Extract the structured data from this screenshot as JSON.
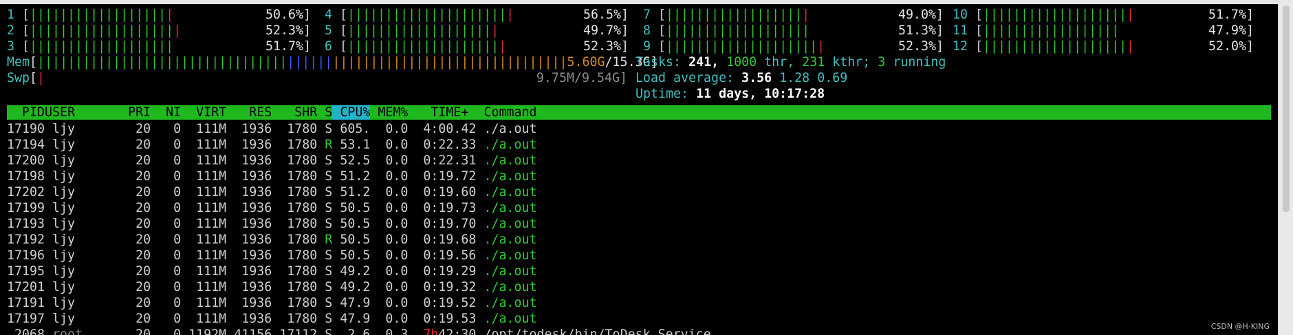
{
  "cpus": [
    {
      "id": "1",
      "pct": "50.6%]",
      "col": 0,
      "row": 0,
      "green": 18,
      "red": 1
    },
    {
      "id": "2",
      "pct": "52.3%]",
      "col": 0,
      "row": 1,
      "green": 19,
      "red": 1
    },
    {
      "id": "3",
      "pct": "51.7%]",
      "col": 0,
      "row": 2,
      "green": 19,
      "red": 0
    },
    {
      "id": "4",
      "pct": "56.5%]",
      "col": 1,
      "row": 0,
      "green": 21,
      "red": 1
    },
    {
      "id": "5",
      "pct": "49.7%]",
      "col": 1,
      "row": 1,
      "green": 19,
      "red": 1
    },
    {
      "id": "6",
      "pct": "52.3%]",
      "col": 1,
      "row": 2,
      "green": 20,
      "red": 1
    },
    {
      "id": "7",
      "pct": "49.0%]",
      "col": 2,
      "row": 0,
      "green": 18,
      "red": 1
    },
    {
      "id": "8",
      "pct": "51.3%]",
      "col": 2,
      "row": 1,
      "green": 19,
      "red": 0
    },
    {
      "id": "9",
      "pct": "52.3%]",
      "col": 2,
      "row": 2,
      "green": 20,
      "red": 1
    },
    {
      "id": "10",
      "pct": "51.7%]",
      "col": 3,
      "row": 0,
      "green": 19,
      "red": 1
    },
    {
      "id": "11",
      "pct": "47.9%]",
      "col": 3,
      "row": 1,
      "green": 18,
      "red": 0
    },
    {
      "id": "12",
      "pct": "52.0%]",
      "col": 3,
      "row": 2,
      "green": 19,
      "red": 1
    }
  ],
  "mem": {
    "label": "Mem",
    "used": "5.60G",
    "total": "/15.3G]",
    "green": 33,
    "blue": 6,
    "orange": 31
  },
  "swp": {
    "label": "Swp",
    "used": "9.75M/9.54G]"
  },
  "tasks": {
    "label": "Tasks:",
    "count": "241,",
    "thr_count": "1000",
    "thr_label": "thr,",
    "kthr_count": "231",
    "kthr_label": "kthr;",
    "running_count": "3",
    "running_label": "running"
  },
  "load": {
    "label": "Load average:",
    "one": "3.56",
    "five": "1.28",
    "fifteen": "0.69"
  },
  "uptime": {
    "label": "Uptime:",
    "value": "11 days, 10:17:28"
  },
  "columns": [
    "  PID",
    "USER      ",
    " PRI",
    "  NI",
    "  VIRT",
    "   RES",
    "   SHR",
    " S",
    " CPU%",
    " MEM%",
    "   TIME+ ",
    " Command"
  ],
  "processes": [
    {
      "pid": "17190",
      "user": "ljy",
      "pri": "20",
      "ni": "0",
      "virt": "111M",
      "res": "1936",
      "shr": "1780",
      "s": "S",
      "cpu": "605.",
      "mem": "0.0",
      "time": "4:00.42",
      "cmd": "./a.out"
    },
    {
      "pid": "17194",
      "user": "ljy",
      "pri": "20",
      "ni": "0",
      "virt": "111M",
      "res": "1936",
      "shr": "1780",
      "s": "R",
      "cpu": "53.1",
      "mem": "0.0",
      "time": "0:22.33",
      "cmd": "./a.out"
    },
    {
      "pid": "17200",
      "user": "ljy",
      "pri": "20",
      "ni": "0",
      "virt": "111M",
      "res": "1936",
      "shr": "1780",
      "s": "S",
      "cpu": "52.5",
      "mem": "0.0",
      "time": "0:22.31",
      "cmd": "./a.out"
    },
    {
      "pid": "17198",
      "user": "ljy",
      "pri": "20",
      "ni": "0",
      "virt": "111M",
      "res": "1936",
      "shr": "1780",
      "s": "S",
      "cpu": "51.2",
      "mem": "0.0",
      "time": "0:19.72",
      "cmd": "./a.out"
    },
    {
      "pid": "17202",
      "user": "ljy",
      "pri": "20",
      "ni": "0",
      "virt": "111M",
      "res": "1936",
      "shr": "1780",
      "s": "S",
      "cpu": "51.2",
      "mem": "0.0",
      "time": "0:19.60",
      "cmd": "./a.out"
    },
    {
      "pid": "17199",
      "user": "ljy",
      "pri": "20",
      "ni": "0",
      "virt": "111M",
      "res": "1936",
      "shr": "1780",
      "s": "S",
      "cpu": "50.5",
      "mem": "0.0",
      "time": "0:19.73",
      "cmd": "./a.out"
    },
    {
      "pid": "17193",
      "user": "ljy",
      "pri": "20",
      "ni": "0",
      "virt": "111M",
      "res": "1936",
      "shr": "1780",
      "s": "S",
      "cpu": "50.5",
      "mem": "0.0",
      "time": "0:19.70",
      "cmd": "./a.out"
    },
    {
      "pid": "17192",
      "user": "ljy",
      "pri": "20",
      "ni": "0",
      "virt": "111M",
      "res": "1936",
      "shr": "1780",
      "s": "R",
      "cpu": "50.5",
      "mem": "0.0",
      "time": "0:19.68",
      "cmd": "./a.out"
    },
    {
      "pid": "17196",
      "user": "ljy",
      "pri": "20",
      "ni": "0",
      "virt": "111M",
      "res": "1936",
      "shr": "1780",
      "s": "S",
      "cpu": "50.5",
      "mem": "0.0",
      "time": "0:19.56",
      "cmd": "./a.out"
    },
    {
      "pid": "17195",
      "user": "ljy",
      "pri": "20",
      "ni": "0",
      "virt": "111M",
      "res": "1936",
      "shr": "1780",
      "s": "S",
      "cpu": "49.2",
      "mem": "0.0",
      "time": "0:19.29",
      "cmd": "./a.out"
    },
    {
      "pid": "17201",
      "user": "ljy",
      "pri": "20",
      "ni": "0",
      "virt": "111M",
      "res": "1936",
      "shr": "1780",
      "s": "S",
      "cpu": "49.2",
      "mem": "0.0",
      "time": "0:19.32",
      "cmd": "./a.out"
    },
    {
      "pid": "17191",
      "user": "ljy",
      "pri": "20",
      "ni": "0",
      "virt": "111M",
      "res": "1936",
      "shr": "1780",
      "s": "S",
      "cpu": "47.9",
      "mem": "0.0",
      "time": "0:19.52",
      "cmd": "./a.out"
    },
    {
      "pid": "17197",
      "user": "ljy",
      "pri": "20",
      "ni": "0",
      "virt": "111M",
      "res": "1936",
      "shr": "1780",
      "s": "S",
      "cpu": "47.9",
      "mem": "0.0",
      "time": "0:19.53",
      "cmd": "./a.out"
    },
    {
      "pid": "2068",
      "user": "root",
      "pri": "20",
      "ni": "0",
      "virt": "1192M",
      "res": "41156",
      "shr": "17112",
      "s": "S",
      "cpu": "2.6",
      "mem": "0.3",
      "time_h": "7h",
      "time": "42:30",
      "cmd": "/opt/todesk/bin/ToDesk Service"
    }
  ],
  "watermark": "CSDN @H-KING",
  "colors": {
    "green": "#2fcc2f",
    "cyan": "#41c0c0",
    "red": "#e23030",
    "blue": "#3b5bff",
    "orange": "#d98a1a",
    "header_bg": "#1fb81f",
    "sort_bg": "#23b3c9"
  }
}
